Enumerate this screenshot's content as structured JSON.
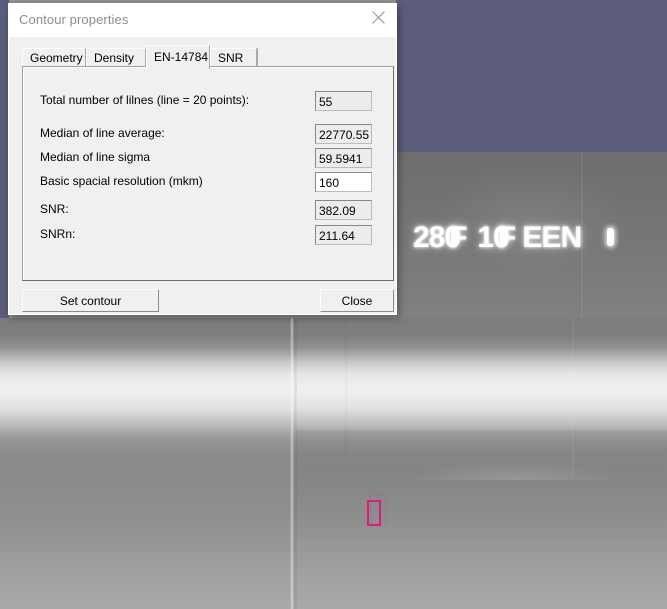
{
  "window": {
    "title": "Contour properties",
    "close_icon": "close-x-icon"
  },
  "tabs": [
    {
      "label": "Geometry",
      "active": false
    },
    {
      "label": "Density",
      "active": false
    },
    {
      "label": "EN-14784",
      "active": true
    },
    {
      "label": "SNR",
      "active": false
    }
  ],
  "form": {
    "rows": [
      {
        "label": "Total number of lilnes (line = 20 points):",
        "value": "55",
        "editable": false
      },
      {
        "label": "Median of line average:",
        "value": "22770.55",
        "editable": false
      },
      {
        "label": "Median of line sigma",
        "value": "59.5941",
        "editable": false
      },
      {
        "label": "Basic spacial resolution (mkm)",
        "value": "160",
        "editable": true
      },
      {
        "label": "SNR:",
        "value": "382.09",
        "editable": false
      },
      {
        "label": "SNRn:",
        "value": "211.64",
        "editable": false
      }
    ]
  },
  "buttons": {
    "set_contour": "Set contour",
    "close": "Close"
  },
  "radiograph": {
    "marker_text_a": "280",
    "marker_text_b": "F",
    "marker_text_c": "10",
    "marker_text_d": "F EEN",
    "roi_label": "contour-roi-rectangle"
  },
  "colors": {
    "desktop": "#5c5c7c",
    "dialog_face": "#f0f0f0",
    "roi_accent": "#e0197d",
    "title_text": "#8d8d8d"
  }
}
